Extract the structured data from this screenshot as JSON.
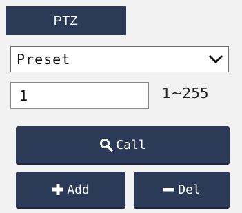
{
  "ptz": {
    "tab_label": "PTZ",
    "mode_select": {
      "value": "Preset",
      "icon": "chevron-down-icon"
    },
    "number_input": {
      "value": "1",
      "range_hint": "1~255"
    },
    "buttons": {
      "call": {
        "label": "Call",
        "icon": "search-icon"
      },
      "add": {
        "label": "Add",
        "icon": "plus-icon"
      },
      "del": {
        "label": "Del",
        "icon": "minus-icon"
      }
    }
  },
  "colors": {
    "button_bg": "#2b3a57",
    "panel_bg": "#f2f2f2",
    "text_on_button": "#ffffff"
  }
}
